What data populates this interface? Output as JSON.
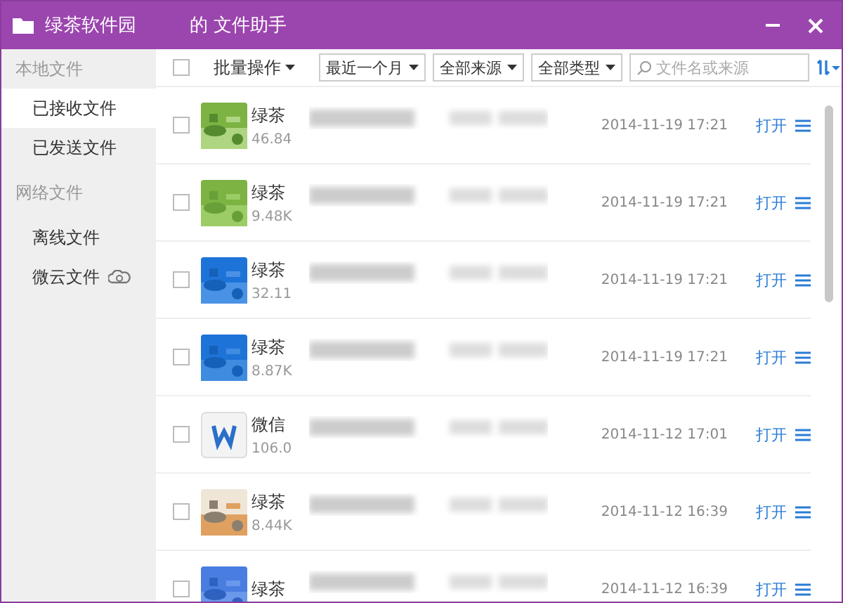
{
  "window": {
    "title_parts": [
      "绿茶软件园",
      "的 文件助手"
    ]
  },
  "sidebar": {
    "sections": [
      {
        "title": "本地文件",
        "items": [
          {
            "label": "已接收文件",
            "selected": true,
            "kind": "plain"
          },
          {
            "label": "已发送文件",
            "selected": false,
            "kind": "plain"
          }
        ]
      },
      {
        "title": "网络文件",
        "items": [
          {
            "label": "离线文件",
            "selected": false,
            "kind": "plain"
          },
          {
            "label": "微云文件",
            "selected": false,
            "kind": "cloud"
          }
        ]
      }
    ]
  },
  "toolbar": {
    "select_all": {
      "checked": false
    },
    "batch": "批量操作",
    "filters": [
      "最近一个月",
      "全部来源",
      "全部类型"
    ],
    "search": {
      "placeholder": "文件名或来源"
    }
  },
  "files": [
    {
      "checked": false,
      "name": "绿茶",
      "size": "46.84",
      "date": "2014-11-19 17:21",
      "action": "打开"
    },
    {
      "checked": false,
      "name": "绿茶",
      "size": "9.48K",
      "date": "2014-11-19 17:21",
      "action": "打开"
    },
    {
      "checked": false,
      "name": "绿茶",
      "size": "32.11",
      "date": "2014-11-19 17:21",
      "action": "打开"
    },
    {
      "checked": false,
      "name": "绿茶",
      "size": "8.87K",
      "date": "2014-11-19 17:21",
      "action": "打开"
    },
    {
      "checked": false,
      "thumb": {
        "kind": "document"
      },
      "name": "微信",
      "size": "106.0",
      "date": "2014-11-12 17:01",
      "action": "打开"
    },
    {
      "checked": false,
      "name": "绿茶",
      "size": "8.44K",
      "date": "2014-11-12 16:39",
      "action": "打开"
    },
    {
      "checked": false,
      "name": "绿茶",
      "date": "2014-11-12 16:39",
      "action": "打开"
    }
  ]
}
